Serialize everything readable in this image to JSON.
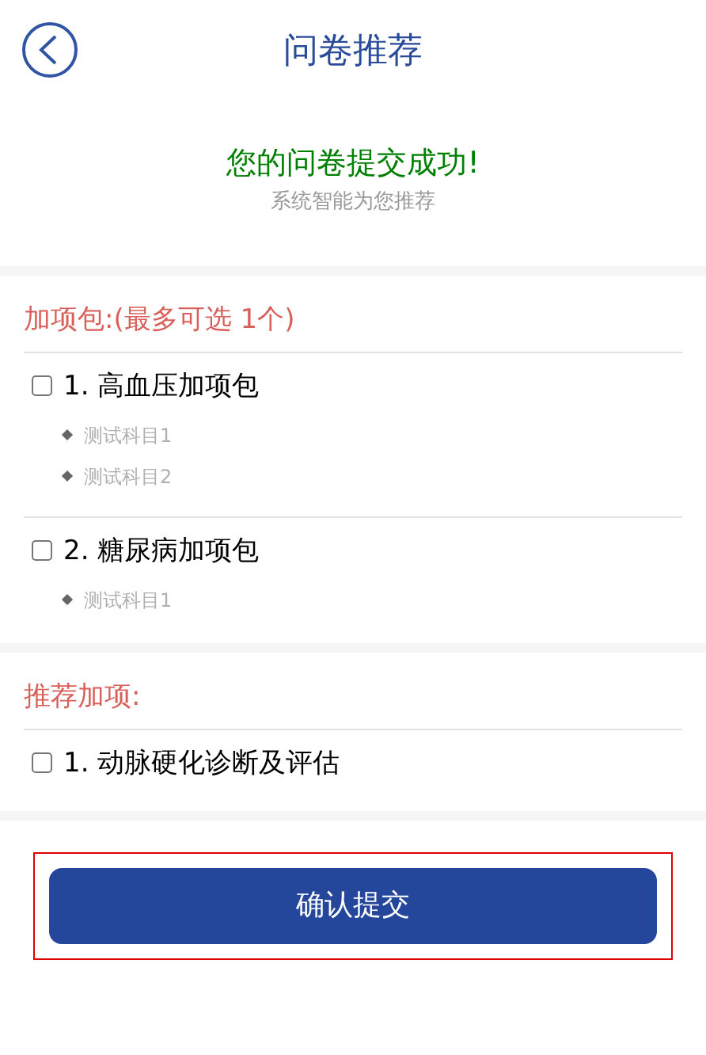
{
  "header": {
    "title": "问卷推荐"
  },
  "result": {
    "message": "您的问卷提交成功!",
    "subtitle": "系统智能为您推荐"
  },
  "sections": [
    {
      "title": "加项包:(最多可选 1个)",
      "items": [
        {
          "label": "1. 高血压加项包",
          "checked": false,
          "details": [
            "测试科目1",
            "测试科目2"
          ]
        },
        {
          "label": "2. 糖尿病加项包",
          "checked": false,
          "details": [
            "测试科目1"
          ]
        }
      ]
    },
    {
      "title": "推荐加项:",
      "items": [
        {
          "label": "1. 动脉硬化诊断及评估",
          "checked": false
        }
      ]
    }
  ],
  "submit_button": "确认提交"
}
